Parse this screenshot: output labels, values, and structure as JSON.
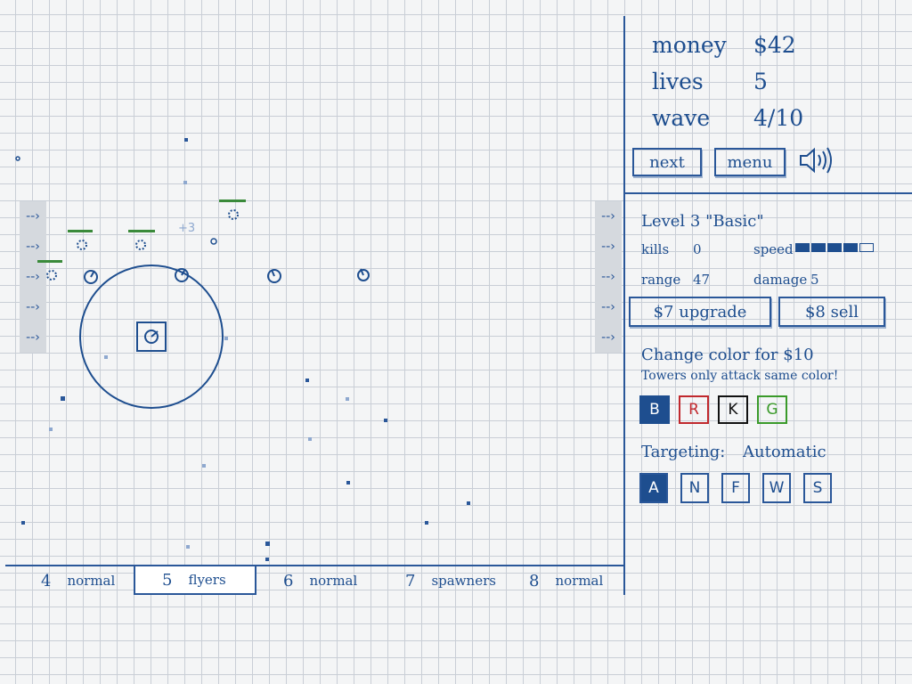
{
  "stats": {
    "money_label": "money",
    "money_value": "$42",
    "lives_label": "lives",
    "lives_value": "5",
    "wave_label": "wave",
    "wave_value": "4/10"
  },
  "controls": {
    "next_label": "next",
    "menu_label": "menu",
    "sound_icon": "speaker-icon"
  },
  "tower": {
    "title": "Level 3 \"Basic\"",
    "kills_label": "kills",
    "kills_value": "0",
    "speed_label": "speed",
    "speed_level": 4,
    "speed_max": 5,
    "range_label": "range",
    "range_value": "47",
    "damage_label": "damage",
    "damage_value": "5",
    "upgrade_label": "$7 upgrade",
    "sell_label": "$8 sell"
  },
  "color": {
    "title": "Change color for $10",
    "subtitle": "Towers only attack same color!",
    "options": [
      {
        "label": "B",
        "color": "#1e4e8f",
        "selected": true
      },
      {
        "label": "R",
        "color": "#c0282d",
        "selected": false
      },
      {
        "label": "K",
        "color": "#111111",
        "selected": false
      },
      {
        "label": "G",
        "color": "#3a9a2a",
        "selected": false
      }
    ]
  },
  "targeting": {
    "label": "Targeting:",
    "value": "Automatic",
    "options": [
      {
        "label": "A",
        "selected": true
      },
      {
        "label": "N",
        "selected": false
      },
      {
        "label": "F",
        "selected": false
      },
      {
        "label": "W",
        "selected": false
      },
      {
        "label": "S",
        "selected": false
      }
    ]
  },
  "waves": [
    {
      "num": "4",
      "type": "normal",
      "active": false
    },
    {
      "num": "5",
      "type": "flyers",
      "active": true
    },
    {
      "num": "6",
      "type": "normal",
      "active": false
    },
    {
      "num": "7",
      "type": "spawners",
      "active": false
    },
    {
      "num": "8",
      "type": "normal",
      "active": false
    }
  ],
  "field": {
    "floating_text": "+3"
  },
  "colors": {
    "ink": "#1e4e8f",
    "health": "#3a8a3a",
    "grid": "#c9ced6"
  }
}
